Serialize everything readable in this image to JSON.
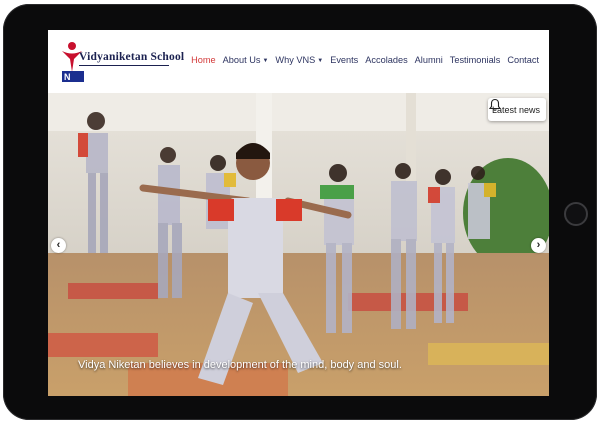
{
  "brand": {
    "name": "Vidyaniketan School"
  },
  "nav": {
    "items": [
      {
        "label": "Home",
        "active": true,
        "dropdown": false
      },
      {
        "label": "About Us",
        "active": false,
        "dropdown": true
      },
      {
        "label": "Why VNS",
        "active": false,
        "dropdown": true
      },
      {
        "label": "Events",
        "active": false,
        "dropdown": false
      },
      {
        "label": "Accolades",
        "active": false,
        "dropdown": false
      },
      {
        "label": "Alumni",
        "active": false,
        "dropdown": false
      },
      {
        "label": "Testimonials",
        "active": false,
        "dropdown": false
      },
      {
        "label": "Contact",
        "active": false,
        "dropdown": false
      }
    ]
  },
  "hero": {
    "caption": "Vidya Niketan believes in development of the mind, body and soul.",
    "news_button": "Latest news",
    "icons": {
      "news": "bell-icon",
      "prev": "chevron-left-icon",
      "next": "chevron-right-icon"
    }
  },
  "colors": {
    "accent": "#d33a3a",
    "brand_navy": "#1b2150",
    "device": "#0b0b0c"
  }
}
